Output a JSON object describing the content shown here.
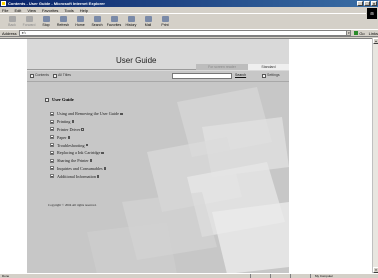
{
  "window": {
    "title": "Contents - User Guide - Microsoft Internet Explorer",
    "controls": [
      "_",
      "□",
      "×"
    ]
  },
  "menu": [
    "File",
    "Edit",
    "View",
    "Favorites",
    "Tools",
    "Help"
  ],
  "toolbar": [
    {
      "label": "Back",
      "icon": "back-arrow-icon",
      "enabled": false
    },
    {
      "label": "Forward",
      "icon": "forward-arrow-icon",
      "enabled": false
    },
    {
      "label": "Stop",
      "icon": "stop-icon",
      "enabled": true
    },
    {
      "label": "Refresh",
      "icon": "refresh-icon",
      "enabled": true
    },
    {
      "label": "Home",
      "icon": "home-icon",
      "enabled": true
    },
    {
      "label": "Search",
      "icon": "search-icon",
      "enabled": true
    },
    {
      "label": "Favorites",
      "icon": "favorites-icon",
      "enabled": true
    },
    {
      "label": "History",
      "icon": "history-icon",
      "enabled": true
    },
    {
      "label": "Mail",
      "icon": "mail-icon",
      "enabled": true
    },
    {
      "label": "Print",
      "icon": "print-icon",
      "enabled": true
    }
  ],
  "address": {
    "label": "Address",
    "value": "e:\\",
    "go": "Go",
    "links": "Links"
  },
  "page": {
    "title": "User Guide",
    "view_modes": {
      "screen": "For screen reader",
      "standard": "Standard"
    },
    "nav": {
      "contents": "Contents",
      "all_titles": "All Titles",
      "search": "Search",
      "settings": "Settings"
    },
    "toc_heading": "User Guide",
    "toc": [
      "Using and Removing the User Guide",
      "Printing",
      "Printer Driver",
      "Paper",
      "Troubleshooting",
      "Replacing a Ink Cartridge",
      "Sharing the Printer",
      "Inquiries and Consumables",
      "Additional Information"
    ],
    "copyright": "Copyright © 2004 All rights reserved."
  },
  "status": {
    "left": "Done",
    "right": "My Computer"
  },
  "colors": {
    "titlebar": "#0a246a",
    "content_bg": "#c7c7c7",
    "header_bg": "#d9d9d9",
    "chrome": "#d4d0c8"
  }
}
